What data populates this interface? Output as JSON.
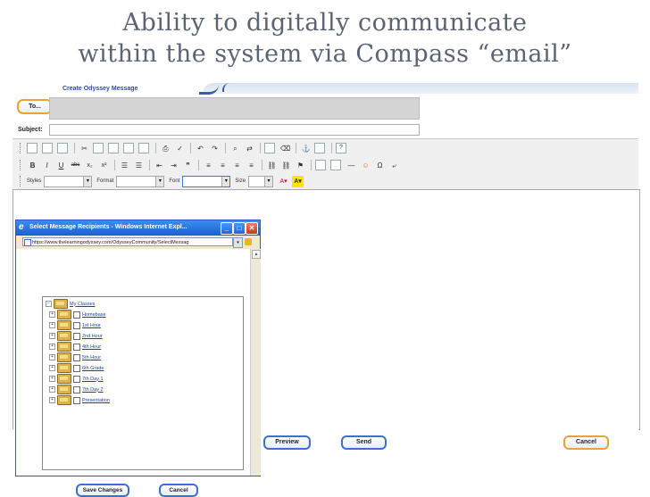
{
  "slide": {
    "title_line1": "Ability to digitally communicate",
    "title_line2": "within the system via Compass “email”"
  },
  "app": {
    "header_title": "Create Odyssey Message",
    "to_button": "To...",
    "subject_label": "Subject:",
    "toolbar": {
      "styles_label": "Styles",
      "format_label": "Format",
      "font_label": "Font",
      "size_label": "Size"
    },
    "buttons": {
      "preview": "Preview",
      "send": "Send",
      "cancel": "Cancel"
    }
  },
  "popup": {
    "title": "Select Message Recipients - Windows Internet Expl...",
    "url": "https://www.thelearningodyssey.com/OdysseyCommunity/SelectMessag",
    "tree_root": "My Classes",
    "tree_items": [
      "Homebase",
      "1st Hour",
      "2nd Hour",
      "4th Hour",
      "5th Hour",
      "6th Grade",
      "7th Day 1",
      "7th Day 2",
      "Presentation"
    ],
    "save_button": "Save Changes",
    "cancel_button": "Cancel"
  }
}
